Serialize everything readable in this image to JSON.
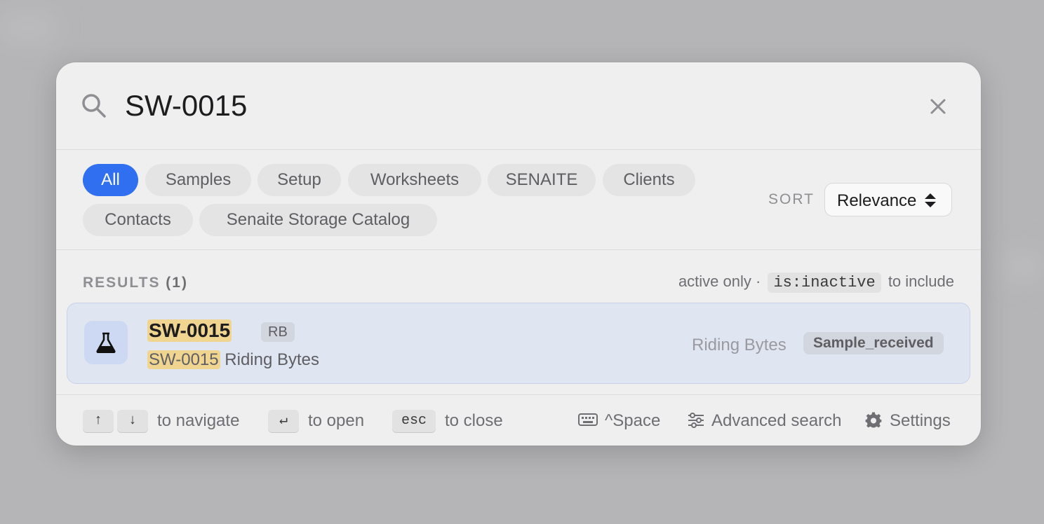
{
  "search": {
    "value": "SW-0015",
    "placeholder": ""
  },
  "filters": [
    {
      "label": "All",
      "active": true
    },
    {
      "label": "Samples"
    },
    {
      "label": "Setup"
    },
    {
      "label": "Worksheets"
    },
    {
      "label": "SENAITE"
    },
    {
      "label": "Clients"
    },
    {
      "label": "Contacts"
    },
    {
      "label": "Senaite Storage Catalog"
    }
  ],
  "sort": {
    "label": "SORT",
    "value": "Relevance"
  },
  "results_header": {
    "label": "RESULTS",
    "count": "(1)"
  },
  "hint": {
    "prefix": "active only ·",
    "code": "is:inactive",
    "suffix": "to include"
  },
  "result": {
    "title": "SW-0015",
    "badge": "RB",
    "sub_id": "SW-0015",
    "sub_text": " Riding Bytes",
    "client": "Riding Bytes",
    "status": "Sample_received",
    "icon": "flask-icon"
  },
  "footer": {
    "up_key": "↑",
    "down_key": "↓",
    "navigate": "to navigate",
    "enter_key": "↵",
    "open": "to open",
    "esc_key": "esc",
    "close": "to close",
    "shortcut": "^Space",
    "advanced": "Advanced search",
    "settings": "Settings"
  },
  "colors": {
    "accent": "#2f6ff0",
    "highlight": "#f0d590",
    "result_bg": "#dfe5f1"
  }
}
